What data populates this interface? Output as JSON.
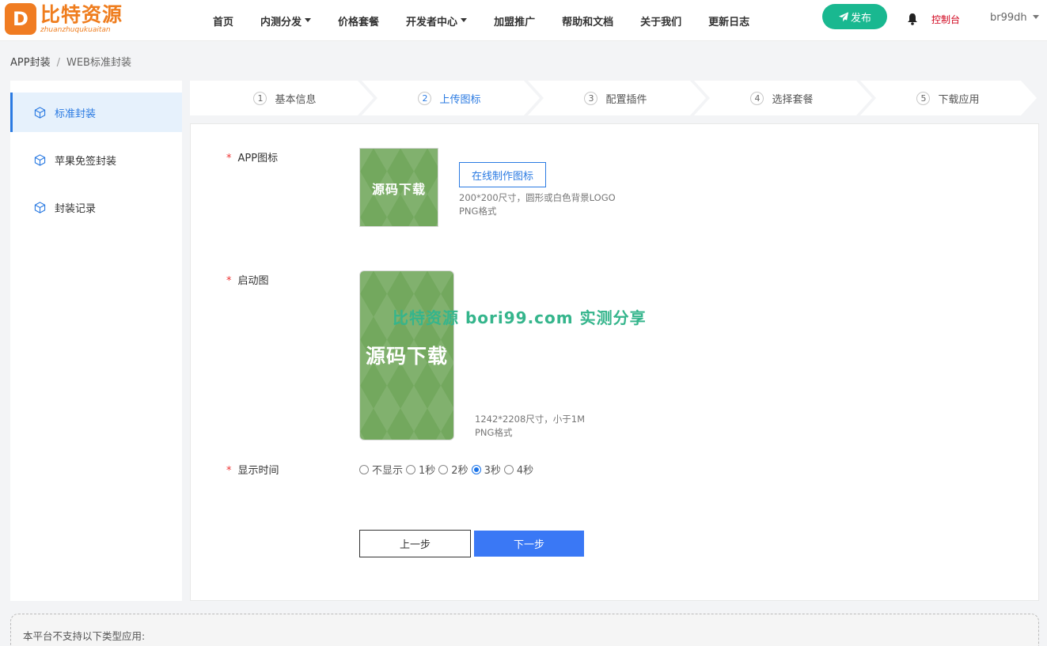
{
  "header": {
    "logo_mark": "D",
    "logo_title": "比特资源",
    "logo_sub": "zhuanzhuqukuaitan",
    "nav": [
      {
        "label": "首页",
        "dropdown": false
      },
      {
        "label": "内测分发",
        "dropdown": true
      },
      {
        "label": "价格套餐",
        "dropdown": false
      },
      {
        "label": "开发者中心",
        "dropdown": true
      },
      {
        "label": "加盟推广",
        "dropdown": false
      },
      {
        "label": "帮助和文档",
        "dropdown": false
      },
      {
        "label": "关于我们",
        "dropdown": false
      },
      {
        "label": "更新日志",
        "dropdown": false
      }
    ],
    "publish_label": "发布",
    "console_label": "控制台",
    "username": "br99dh",
    "accent_color": "#19b890"
  },
  "breadcrumb": {
    "root": "APP封装",
    "separator": "/",
    "current": "WEB标准封装"
  },
  "sidebar": {
    "items": [
      {
        "label": "标准封装",
        "active": true
      },
      {
        "label": "苹果免签封装",
        "active": false
      },
      {
        "label": "封装记录",
        "active": false
      }
    ]
  },
  "steps": [
    {
      "num": "1",
      "label": "基本信息",
      "active": false
    },
    {
      "num": "2",
      "label": "上传图标",
      "active": true
    },
    {
      "num": "3",
      "label": "配置插件",
      "active": false
    },
    {
      "num": "4",
      "label": "选择套餐",
      "active": false
    },
    {
      "num": "5",
      "label": "下载应用",
      "active": false
    }
  ],
  "form": {
    "required_mark": "*",
    "icon_label": "APP图标",
    "icon_thumb_text": "源码下载",
    "make_icon_button": "在线制作图标",
    "icon_hint_1": "200*200尺寸，圆形或白色背景LOGO",
    "icon_hint_2": "PNG格式",
    "splash_label": "启动图",
    "splash_thumb_text": "源码下载",
    "splash_hint_1": "1242*2208尺寸，小于1M",
    "splash_hint_2": "PNG格式",
    "duration_label": "显示时间",
    "duration_options": [
      {
        "label": "不显示",
        "checked": false
      },
      {
        "label": "1秒",
        "checked": false
      },
      {
        "label": "2秒",
        "checked": false
      },
      {
        "label": "3秒",
        "checked": true
      },
      {
        "label": "4秒",
        "checked": false
      }
    ],
    "prev_button": "上一步",
    "next_button": "下一步"
  },
  "watermark": "比特资源 bori99.com 实测分享",
  "notice": {
    "title": "本平台不支持以下类型应用:"
  }
}
